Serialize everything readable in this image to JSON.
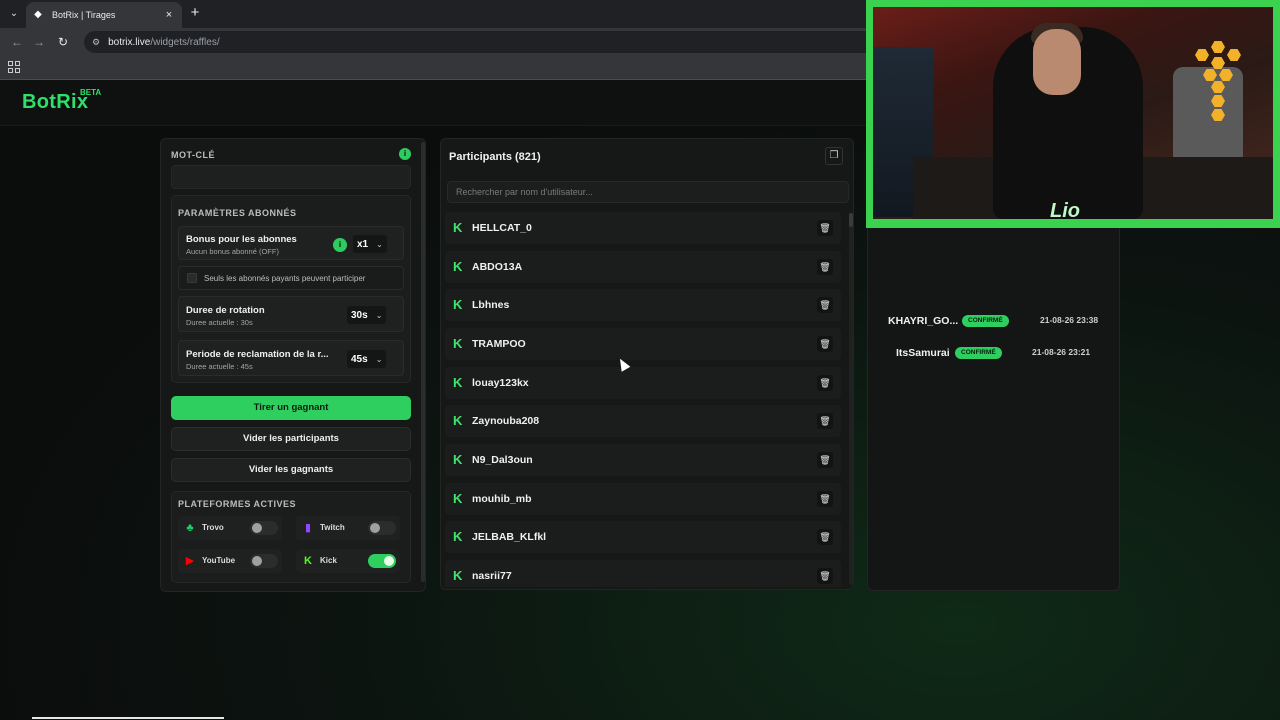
{
  "browser": {
    "tab_title": "BotRix | Tirages",
    "new_tab": "+",
    "url_host": "botrix.live",
    "url_path": "/widgets/raffles/"
  },
  "brand": {
    "logo": "BotRix",
    "beta": "BETA",
    "accent": "#2ee06a"
  },
  "settings": {
    "keyword_label": "MOT-CLÉ",
    "keyword_value": "",
    "sub_params_label": "PARAMÈTRES ABONNÉS",
    "bonus_title": "Bonus pour les abonnes",
    "bonus_sub": "Aucun bonus abonné (OFF)",
    "bonus_value": "x1",
    "paid_only_label": "Seuls les abonnés payants peuvent participer",
    "rotation_title": "Duree de rotation",
    "rotation_sub": "Duree actuelle : 30s",
    "rotation_value": "30s",
    "claim_title": "Periode de reclamation de la r...",
    "claim_sub": "Duree actuelle : 45s",
    "claim_value": "45s"
  },
  "actions": {
    "draw": "Tirer un gagnant",
    "clear_participants": "Vider les participants",
    "clear_winners": "Vider les gagnants"
  },
  "platforms": {
    "label": "PLATEFORMES ACTIVES",
    "items": [
      {
        "name": "Trovo",
        "enabled": false,
        "color": "#19d66b"
      },
      {
        "name": "Twitch",
        "enabled": false,
        "color": "#9146ff"
      },
      {
        "name": "YouTube",
        "enabled": false,
        "color": "#ff0000"
      },
      {
        "name": "Kick",
        "enabled": true,
        "color": "#53fc18"
      }
    ]
  },
  "participants": {
    "title": "Participants (821)",
    "search_placeholder": "Rechercher par nom d'utilisateur...",
    "list": [
      "HELLCAT_0",
      "ABDO13A",
      "Lbhnes",
      "TRAMPOO",
      "louay123kx",
      "Zaynouba208",
      "N9_Dal3oun",
      "mouhib_mb",
      "JELBAB_KLfkl",
      "nasrii77"
    ]
  },
  "winners": [
    {
      "name": "KHAYRI_GO...",
      "status": "CONFIRMÉ",
      "date": "21-08-26 23:38"
    },
    {
      "name": "ItsSamurai",
      "status": "CONFIRMÉ",
      "date": "21-08-26 23:21"
    }
  ],
  "webcam": {
    "overlay_text": "Lio",
    "frame_color": "#3bd24f"
  }
}
